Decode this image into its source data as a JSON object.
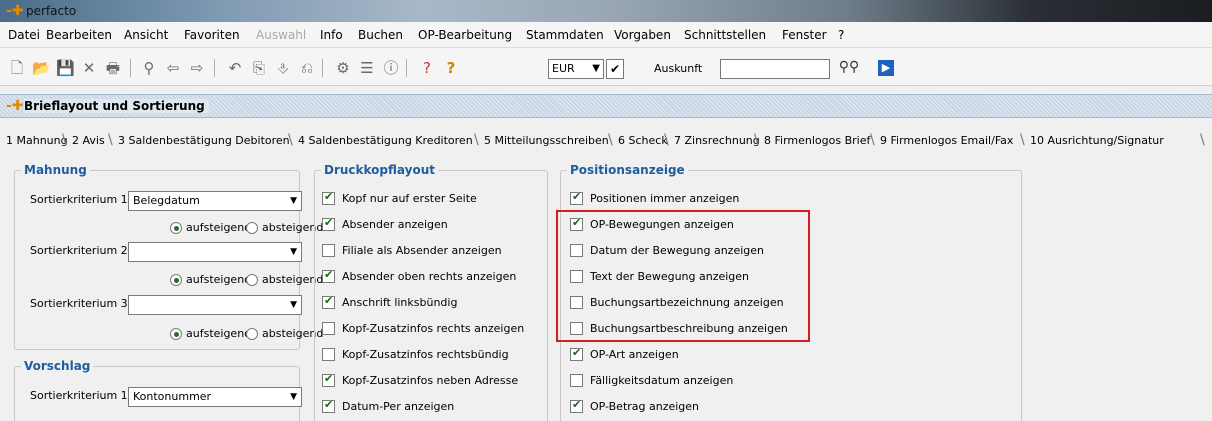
{
  "app": {
    "title": "perfacto"
  },
  "menu": [
    {
      "label": "Datei"
    },
    {
      "label": "Bearbeiten"
    },
    {
      "label": "Ansicht"
    },
    {
      "label": "Favoriten"
    },
    {
      "label": "Auswahl"
    },
    {
      "label": "Info"
    },
    {
      "label": "Buchen"
    },
    {
      "label": "OP-Bearbeitung"
    },
    {
      "label": "Stammdaten"
    },
    {
      "label": "Vorgaben"
    },
    {
      "label": "Schnittstellen"
    },
    {
      "label": "Fenster"
    },
    {
      "label": "?"
    }
  ],
  "toolbar": {
    "currency": "EUR",
    "auskunft_label": "Auskunft",
    "auskunft_value": ""
  },
  "window": {
    "title": "Brieflayout und Sortierung"
  },
  "tabs": [
    "1 Mahnung",
    "2 Avis",
    "3 Saldenbestätigung Debitoren",
    "4 Saldenbestätigung Kreditoren",
    "5 Mitteilungsschreiben",
    "6 Scheck",
    "7 Zinsrechnung",
    "8 Firmenlogos Brief",
    "9 Firmenlogos Email/Fax",
    "10 Ausrichtung/Signatur"
  ],
  "mahnung": {
    "legend": "Mahnung",
    "rows": [
      {
        "label": "Sortierkriterium 1",
        "value": "Belegdatum",
        "asc": "aufsteigend",
        "desc": "absteigend"
      },
      {
        "label": "Sortierkriterium 2",
        "value": "",
        "asc": "aufsteigend",
        "desc": "absteigend"
      },
      {
        "label": "Sortierkriterium 3",
        "value": "",
        "asc": "aufsteigend",
        "desc": "absteigend"
      }
    ]
  },
  "vorschlag": {
    "legend": "Vorschlag",
    "rows": [
      {
        "label": "Sortierkriterium 1",
        "value": "Kontonummer"
      }
    ]
  },
  "druckkopf": {
    "legend": "Druckkopflayout",
    "items": [
      {
        "label": "Kopf nur auf erster Seite",
        "checked": true
      },
      {
        "label": "Absender anzeigen",
        "checked": true
      },
      {
        "label": "Filiale als Absender anzeigen",
        "checked": false
      },
      {
        "label": "Absender oben rechts anzeigen",
        "checked": true
      },
      {
        "label": "Anschrift linksbündig",
        "checked": true
      },
      {
        "label": "Kopf-Zusatzinfos rechts anzeigen",
        "checked": false
      },
      {
        "label": "Kopf-Zusatzinfos rechtsbündig",
        "checked": false
      },
      {
        "label": "Kopf-Zusatzinfos neben Adresse",
        "checked": true
      },
      {
        "label": "Datum-Per anzeigen",
        "checked": true
      }
    ]
  },
  "positionen": {
    "legend": "Positionsanzeige",
    "items": [
      {
        "label": "Positionen immer anzeigen",
        "checked": true
      },
      {
        "label": "OP-Bewegungen anzeigen",
        "checked": true
      },
      {
        "label": "Datum der Bewegung anzeigen",
        "checked": false
      },
      {
        "label": "Text der Bewegung anzeigen",
        "checked": false
      },
      {
        "label": "Buchungsartbezeichnung anzeigen",
        "checked": false
      },
      {
        "label": "Buchungsartbeschreibung anzeigen",
        "checked": false
      },
      {
        "label": "OP-Art anzeigen",
        "checked": true
      },
      {
        "label": "Fälligkeitsdatum anzeigen",
        "checked": false
      },
      {
        "label": "OP-Betrag anzeigen",
        "checked": true
      }
    ]
  },
  "colors": {
    "legend": "#1f5da0",
    "highlight": "#d21f1f",
    "accent": "#e08a00"
  }
}
